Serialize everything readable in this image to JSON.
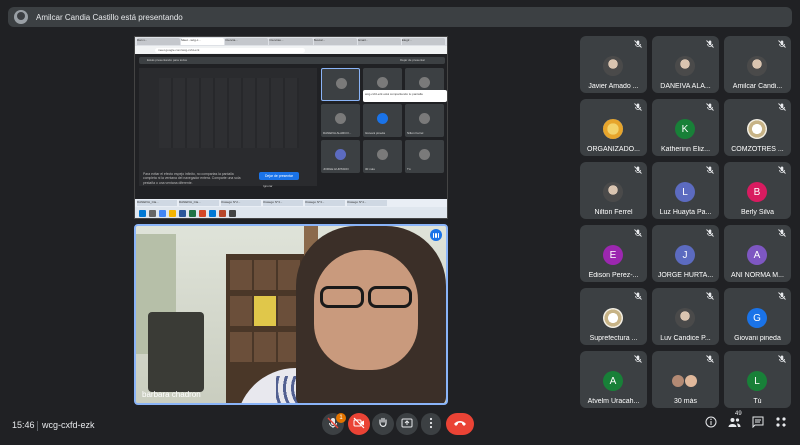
{
  "banner": {
    "text": "Amilcar Candia Castillo está presentando"
  },
  "shared_screen": {
    "tabs": [
      "Dan v...",
      "Meet - wcg-c...",
      "Ciencia...",
      "Ciencias...",
      "Buscar...",
      "Gmail...",
      "Elegir..."
    ],
    "url": "meet.google.com/wcg-cxfd-ezk",
    "inner_banner": "Estás presentando para todos",
    "inner_banner_right": "Dejar de presentar",
    "note": "Para evitar el efecto espejo infinito, no compartas la pantalla completa ni la ventana del navegador entera. Comparte una sola pestaña o una ventana diferente.",
    "stop_button": "Dejar de presentar",
    "ignore": "Ignorar",
    "popup": "wcg-cxfd-ezk está compartiendo tu pantalla",
    "tiles": [
      "",
      "Oswaldo Champa...",
      "LIDYA EDITH PALO...",
      "DANEIVA ALARCO...",
      "Giovani pineda",
      "Nilton Ferrel",
      "JORGE HURTADO",
      "30 más",
      "Tú"
    ],
    "time": "15:45",
    "code": "wcg-cxfd-ezk",
    "taskbar": [
      "DANEIVA_Cla...",
      "DANEIVA_Cla...",
      "Oswego N°2...",
      "Oswego N°3...",
      "Oswego N°3...",
      "Oswego N°4..."
    ]
  },
  "presenter": {
    "name": "barbara chadron"
  },
  "participants": [
    {
      "name": "Javier Amado ...",
      "avatar": "photo",
      "initial": "",
      "color": ""
    },
    {
      "name": "DANEIVA ALA...",
      "avatar": "photo",
      "initial": "",
      "color": ""
    },
    {
      "name": "Amilcar Candi...",
      "avatar": "photo",
      "initial": "",
      "color": ""
    },
    {
      "name": "ORGANIZADO...",
      "avatar": "logo",
      "initial": "",
      "color": ""
    },
    {
      "name": "Katherinn Eliz...",
      "avatar": "letter",
      "initial": "K",
      "color": "#188038"
    },
    {
      "name": "COMZOTRES ...",
      "avatar": "seal",
      "initial": "",
      "color": ""
    },
    {
      "name": "Nilton Ferrel",
      "avatar": "photo",
      "initial": "",
      "color": ""
    },
    {
      "name": "Luz Huayta Pa...",
      "avatar": "letter",
      "initial": "L",
      "color": "#5c6bc0"
    },
    {
      "name": "Berly Silva",
      "avatar": "letter",
      "initial": "B",
      "color": "#d81b60"
    },
    {
      "name": "Edison Perez-...",
      "avatar": "letter",
      "initial": "E",
      "color": "#9c27b0"
    },
    {
      "name": "JORGE HURTA...",
      "avatar": "letter",
      "initial": "J",
      "color": "#5c6bc0"
    },
    {
      "name": "ANI NORMA M...",
      "avatar": "letter",
      "initial": "A",
      "color": "#7e57c2"
    },
    {
      "name": "Suprefectura ...",
      "avatar": "seal",
      "initial": "",
      "color": ""
    },
    {
      "name": "Luv Candice P...",
      "avatar": "photo",
      "initial": "",
      "color": ""
    },
    {
      "name": "Giovani pineda",
      "avatar": "letter",
      "initial": "G",
      "color": "#1a73e8"
    },
    {
      "name": "Atvelm Uracah...",
      "avatar": "letter",
      "initial": "A",
      "color": "#188038"
    },
    {
      "name": "30 más",
      "avatar": "pair",
      "initial": "",
      "color": ""
    },
    {
      "name": "Tú",
      "avatar": "letter",
      "initial": "L",
      "color": "#188038"
    }
  ],
  "bottom_bar": {
    "time": "15:46",
    "meeting_code": "wcg-cxfd-ezk",
    "mic_badge": "1",
    "people_count": "49",
    "icons": [
      "mic-off-icon",
      "camera-off-icon",
      "raise-hand-icon",
      "present-icon",
      "more-options-icon",
      "end-call-icon",
      "info-icon",
      "people-icon",
      "chat-icon",
      "activities-icon"
    ]
  },
  "colors": {
    "background": "#202124",
    "tile": "#3c4043",
    "end_call": "#ea4335",
    "accent": "#8ab4f8"
  }
}
